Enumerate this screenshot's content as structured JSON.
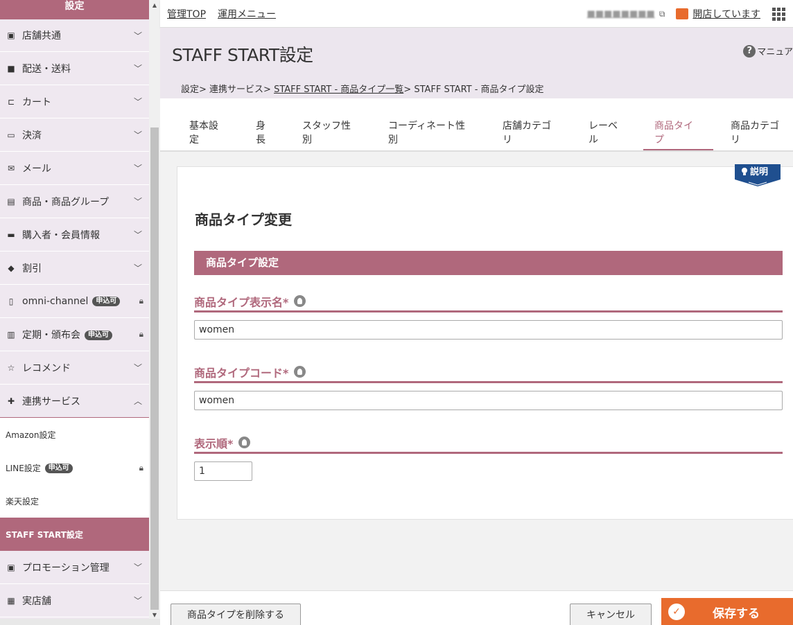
{
  "sidebar": {
    "header": "設定",
    "items": [
      {
        "icon": "monitor-icon",
        "label": "店舗共通"
      },
      {
        "icon": "truck-icon",
        "label": "配送・送料"
      },
      {
        "icon": "cart-icon",
        "label": "カート"
      },
      {
        "icon": "credit-card-icon",
        "label": "決済"
      },
      {
        "icon": "mail-icon",
        "label": "メール"
      },
      {
        "icon": "product-icon",
        "label": "商品・商品グループ"
      },
      {
        "icon": "id-card-icon",
        "label": "購入者・会員情報"
      },
      {
        "icon": "tag-icon",
        "label": "割引"
      },
      {
        "icon": "phone-icon",
        "label": "omni-channel",
        "badge": "申込可"
      },
      {
        "icon": "calendar-icon",
        "label": "定期・頒布会",
        "badge": "申込可"
      },
      {
        "icon": "recommend-icon",
        "label": "レコメンド"
      },
      {
        "icon": "puzzle-icon",
        "label": "連携サービス"
      },
      {
        "icon": "pr-icon",
        "label": "プロモーション管理"
      },
      {
        "icon": "store-icon",
        "label": "実店舗"
      }
    ],
    "sub_items": [
      {
        "label": "Amazon設定"
      },
      {
        "label": "LINE設定",
        "badge": "申込可"
      },
      {
        "label": "楽天設定"
      },
      {
        "label": "STAFF START設定"
      }
    ]
  },
  "topbar": {
    "admin_top": "管理TOP",
    "ops_menu": "運用メニュー",
    "shop_name_blurred": "■■■■■■■■",
    "store_status": "開店しています"
  },
  "header": {
    "title": "STAFF START設定",
    "help": "マニュア",
    "breadcrumb": {
      "part1": "設定> 連携サービス> ",
      "link": "STAFF START - 商品タイプ一覧",
      "part2": "> STAFF START - 商品タイプ設定"
    }
  },
  "tabs": [
    {
      "line1": "基本設",
      "line2": "定"
    },
    {
      "line1": "身",
      "line2": "長"
    },
    {
      "line1": "スタッフ性",
      "line2": "別"
    },
    {
      "line1": "コーディネート性",
      "line2": "別"
    },
    {
      "line1": "店舗カテゴ",
      "line2": "リ"
    },
    {
      "line1": "レーベ",
      "line2": "ル"
    },
    {
      "line1": "商品タイ",
      "line2": "プ"
    },
    {
      "line1": "商品カテゴ",
      "line2": "リ"
    }
  ],
  "panel": {
    "setsumei": "説明",
    "title": "商品タイプ変更",
    "section": "商品タイプ設定",
    "fields": [
      {
        "label": "商品タイプ表示名*",
        "value": "women"
      },
      {
        "label": "商品タイプコード*",
        "value": "women"
      },
      {
        "label": "表示順*",
        "value": "1"
      }
    ]
  },
  "footer": {
    "delete": "商品タイプを削除する",
    "cancel": "キャンセル",
    "save": "保存する"
  },
  "colors": {
    "accent": "#b0687c",
    "sidebar_bg": "#efe8f0",
    "save": "#e86b2d"
  }
}
